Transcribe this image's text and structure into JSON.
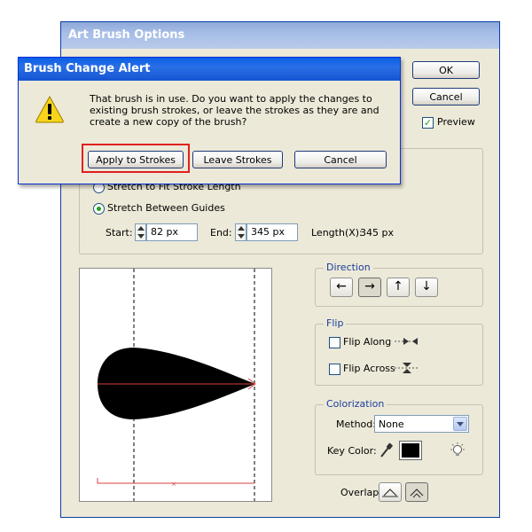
{
  "art_dialog": {
    "title": "Art Brush Options",
    "ok_label": "OK",
    "cancel_label": "Cancel",
    "preview_label": "Preview",
    "preview_checked": true,
    "stretch_fit_label": "Stretch to Fit Stroke Length",
    "stretch_guides_label": "Stretch Between Guides",
    "start_label": "Start:",
    "start_value": "82 px",
    "end_label": "End:",
    "end_value": "345 px",
    "length_label": "Length(X):",
    "length_value": "345 px",
    "direction": {
      "label": "Direction",
      "left": "←",
      "right": "→",
      "up": "↑",
      "down": "↓",
      "selected": "right"
    },
    "flip": {
      "label": "Flip",
      "along_label": "Flip Along",
      "across_label": "Flip Across"
    },
    "colorization": {
      "label": "Colorization",
      "method_label": "Method:",
      "method_value": "None",
      "key_color_label": "Key Color:",
      "key_color": "#000000"
    },
    "overlap_label": "Overlap:",
    "preview_stroke_color": "#d94040"
  },
  "alert": {
    "title": "Brush Change Alert",
    "message": "That brush is in use.  Do you want to apply the changes to existing brush strokes, or leave the strokes as they are and create a new copy of the brush?",
    "apply_label": "Apply to Strokes",
    "leave_label": "Leave Strokes",
    "cancel_label": "Cancel",
    "highlight_color": "#e02020"
  }
}
